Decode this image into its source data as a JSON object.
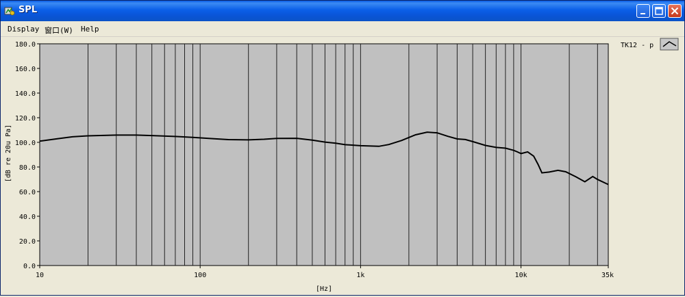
{
  "window": {
    "title": "SPL"
  },
  "menu": {
    "items": [
      "Display",
      "窗口(W)",
      "Help"
    ]
  },
  "legend": {
    "label": "TK12 - p"
  },
  "chart_data": {
    "type": "line",
    "xscale": "log",
    "xlim": [
      10,
      35000
    ],
    "ylim": [
      0,
      180
    ],
    "xlabel": "[Hz]",
    "ylabel": "[dB re 20u Pa]",
    "grid": "vertical",
    "legend_position": "top-right",
    "colors": {
      "line": "#000000",
      "plot_bg": "#c0c0c0",
      "grid": "#202020"
    },
    "y_ticks": [
      "0.0",
      "20.0",
      "40.0",
      "60.0",
      "80.0",
      "100.0",
      "120.0",
      "140.0",
      "160.0",
      "180.0"
    ],
    "y_tick_values": [
      0,
      20,
      40,
      60,
      80,
      100,
      120,
      140,
      160,
      180
    ],
    "x_ticks": [
      "10",
      "100",
      "1k",
      "10k",
      "35k"
    ],
    "x_tick_values": [
      10,
      100,
      1000,
      10000,
      35000
    ],
    "series": [
      {
        "x": [
          10,
          13,
          16,
          20,
          25,
          30,
          40,
          50,
          70,
          90,
          120,
          150,
          200,
          250,
          300,
          400,
          500,
          600,
          700,
          800,
          1000,
          1300,
          1500,
          1800,
          2200,
          2600,
          3000,
          3500,
          4000,
          4500,
          5000,
          6000,
          7000,
          8000,
          9000,
          9500,
          10000,
          11000,
          12000,
          12800,
          13500,
          15000,
          17000,
          19000,
          22000,
          25000,
          28000,
          30000,
          35000
        ],
        "y": [
          101,
          103,
          104.5,
          105.3,
          105.6,
          105.9,
          105.9,
          105.5,
          104.8,
          104,
          103,
          102.2,
          102,
          102.5,
          103.2,
          103.3,
          101.8,
          100.2,
          99.3,
          98.1,
          97.3,
          96.8,
          98.2,
          101.5,
          106.1,
          108.3,
          107.7,
          104.9,
          102.8,
          102.3,
          100.6,
          97.5,
          95.9,
          95.3,
          93.5,
          92.2,
          90.9,
          92.3,
          88.8,
          81.9,
          75.2,
          75.9,
          77.3,
          76.1,
          72,
          68,
          72.3,
          69.9,
          65.8
        ]
      }
    ]
  }
}
